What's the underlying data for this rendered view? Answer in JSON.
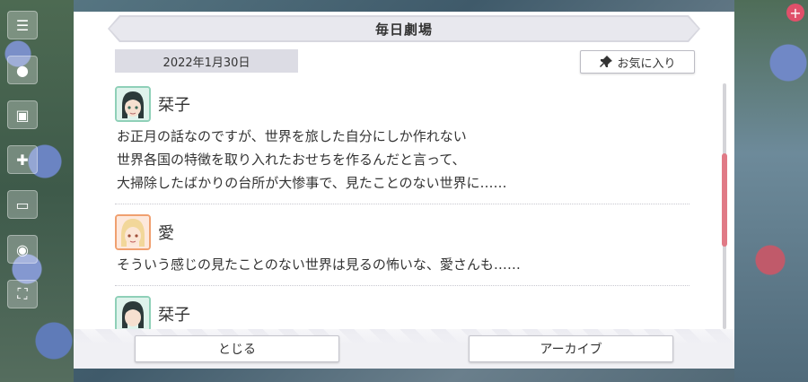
{
  "dialog": {
    "title": "毎日劇場",
    "date": "2022年1月30日",
    "favorite_label": "お気に入り"
  },
  "entries": [
    {
      "speaker": "栞子",
      "lines": [
        "お正月の話なのですが、世界を旅した自分にしか作れない",
        "世界各国の特徴を取り入れたおせちを作るんだと言って、",
        "大掃除したばかりの台所が大惨事で、見たことのない世界に……"
      ]
    },
    {
      "speaker": "愛",
      "lines": [
        "そういう感じの見たことのない世界は見るの怖いな、愛さんも……"
      ]
    },
    {
      "speaker": "栞子",
      "lines": []
    }
  ],
  "buttons": {
    "close_label": "とじる",
    "archive_label": "アーカイブ"
  },
  "icons": {
    "pin": "pin-icon",
    "menu": "menu-icon"
  },
  "colors": {
    "scroll_thumb": "#e07a86",
    "avatar_green": "#8fd0b8",
    "avatar_orange": "#f0a070"
  }
}
